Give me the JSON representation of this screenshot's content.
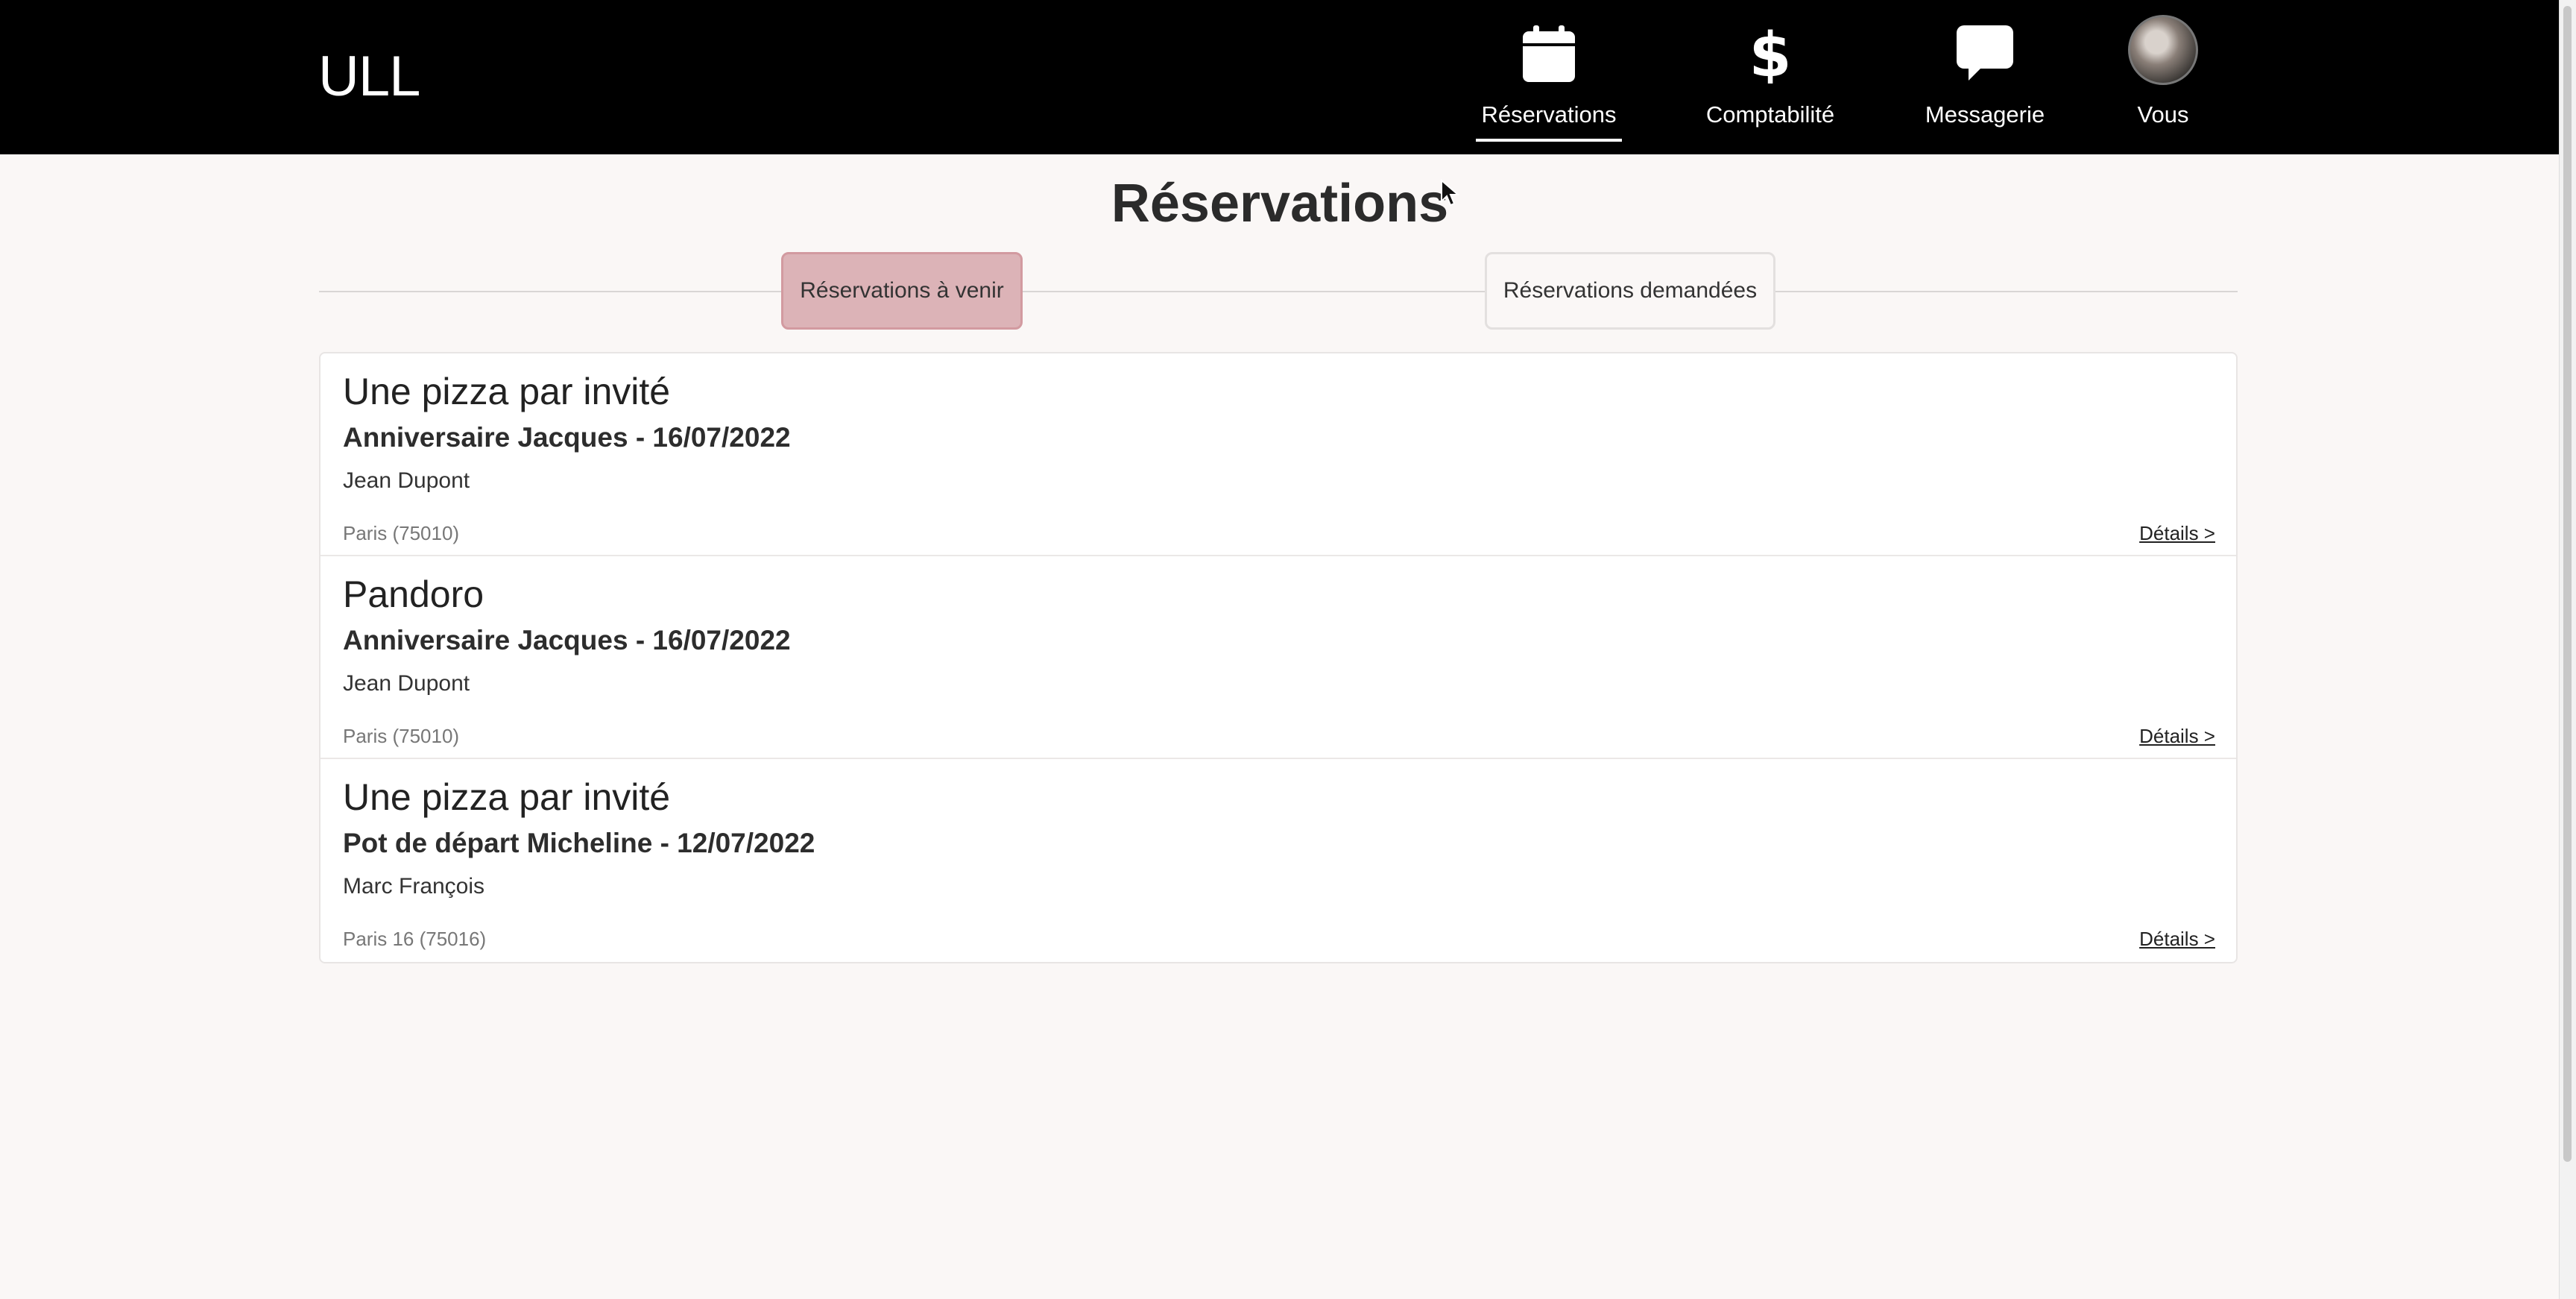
{
  "header": {
    "brand": "ULL",
    "nav": [
      {
        "label": "Réservations",
        "icon": "calendar-icon",
        "active": true
      },
      {
        "label": "Comptabilité",
        "icon": "dollar-icon"
      },
      {
        "label": "Messagerie",
        "icon": "chat-bubble-icon"
      },
      {
        "label": "Vous",
        "icon": "avatar"
      }
    ]
  },
  "page": {
    "title": "Réservations",
    "tabs": [
      {
        "label": "Réservations à venir",
        "active": true
      },
      {
        "label": "Réservations demandées",
        "active": false
      }
    ]
  },
  "reservations": [
    {
      "title": "Une pizza par invité",
      "event": "Anniversaire Jacques - 16/07/2022",
      "person": "Jean Dupont",
      "location": "Paris (75010)",
      "details": "Détails >"
    },
    {
      "title": "Pandoro",
      "event": "Anniversaire Jacques - 16/07/2022",
      "person": "Jean Dupont",
      "location": "Paris (75010)",
      "details": "Détails >"
    },
    {
      "title": "Une pizza par invité",
      "event": "Pot de départ Micheline - 12/07/2022",
      "person": "Marc François",
      "location": "Paris 16 (75016)",
      "details": "Détails >"
    }
  ],
  "colors": {
    "topbar": "#000000",
    "active_tab": "#dcb3b7",
    "background": "#faf7f6"
  }
}
